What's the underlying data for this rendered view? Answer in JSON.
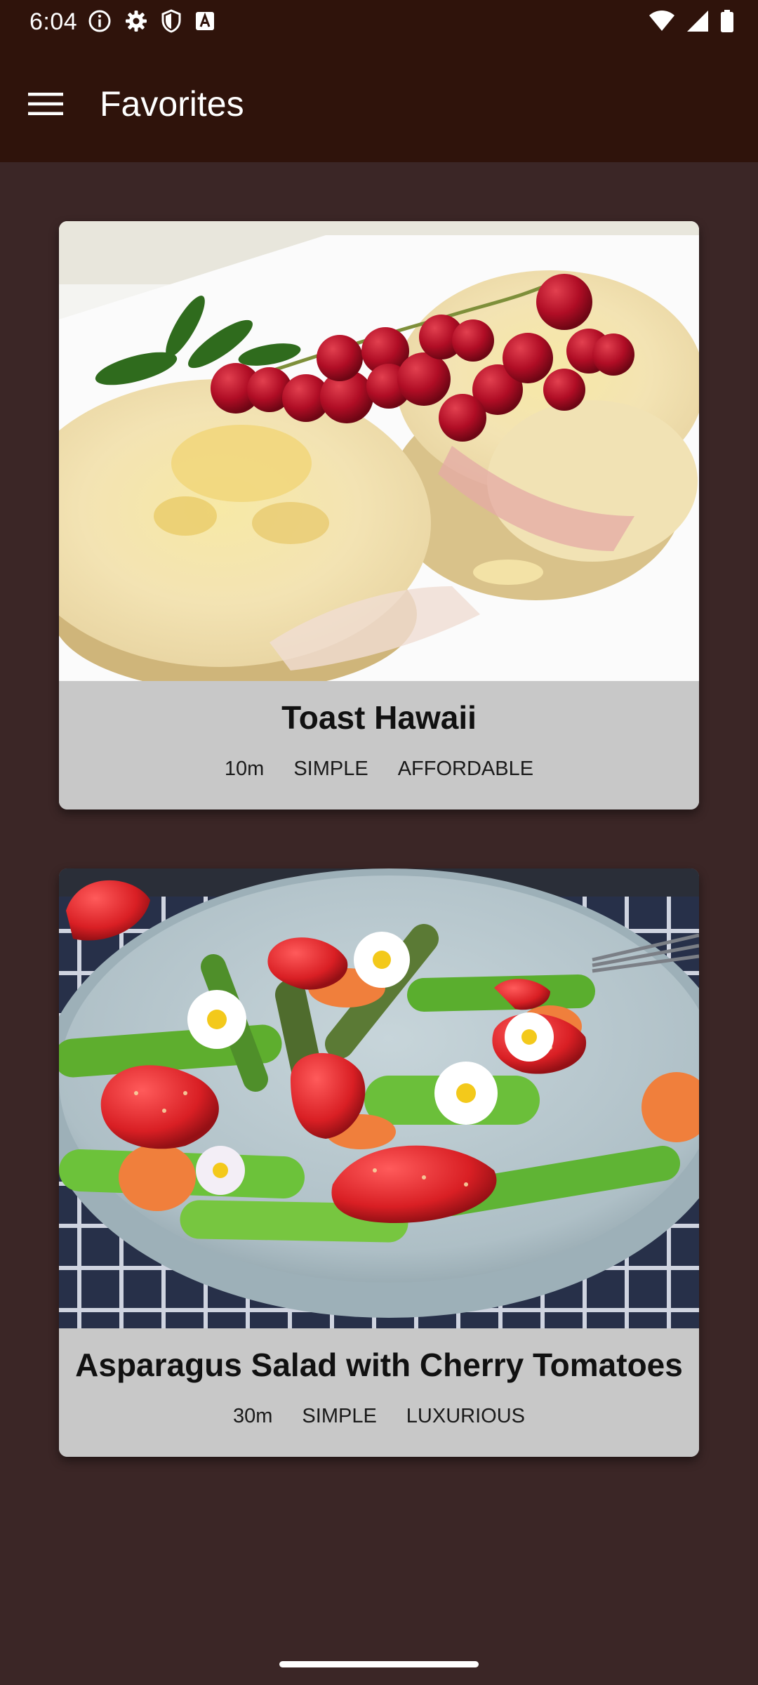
{
  "status_bar": {
    "time": "6:04",
    "left_icons": [
      "info-icon",
      "settings-icon",
      "shield-icon",
      "text-a-icon"
    ],
    "right_icons": [
      "wifi-icon",
      "signal-icon",
      "battery-icon"
    ]
  },
  "app_bar": {
    "menu_icon": "hamburger-menu-icon",
    "title": "Favorites",
    "background_color": "#2f130b"
  },
  "meals": [
    {
      "title": "Toast Hawaii",
      "duration": "10m",
      "complexity": "SIMPLE",
      "affordability": "AFFORDABLE"
    },
    {
      "title": "Asparagus Salad with Cherry Tomatoes",
      "duration": "30m",
      "complexity": "SIMPLE",
      "affordability": "LUXURIOUS"
    }
  ],
  "colors": {
    "page_background": "#3b2626",
    "card_info_background": "#c8c8c8"
  }
}
